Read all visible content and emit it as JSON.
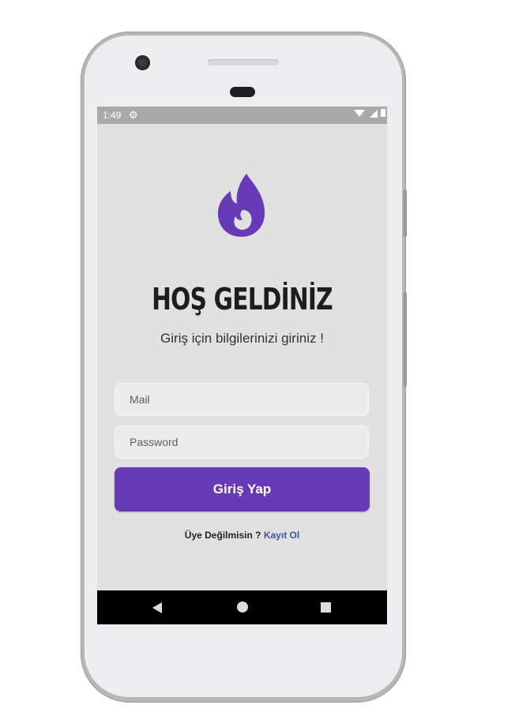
{
  "status_bar": {
    "time": "1:49",
    "settings_icon": "gear-icon",
    "wifi_icon": "wifi-icon",
    "signal_icon": "signal-icon",
    "battery_icon": "battery-icon"
  },
  "logo": {
    "icon": "flame-icon",
    "color": "#673ab7"
  },
  "title": "HOŞ GELDİNİZ",
  "subtitle": "Giriş için bilgilerinizi giriniz !",
  "form": {
    "mail_placeholder": "Mail",
    "password_placeholder": "Password",
    "submit_label": "Giriş Yap",
    "accent_color": "#673ab7"
  },
  "register": {
    "question": "Üye Değilmisin ?",
    "link_label": "Kayıt Ol",
    "link_color": "#3f51b5"
  },
  "nav_bar": {
    "back_icon": "back-triangle-icon",
    "home_icon": "home-circle-icon",
    "recents_icon": "recents-square-icon"
  }
}
